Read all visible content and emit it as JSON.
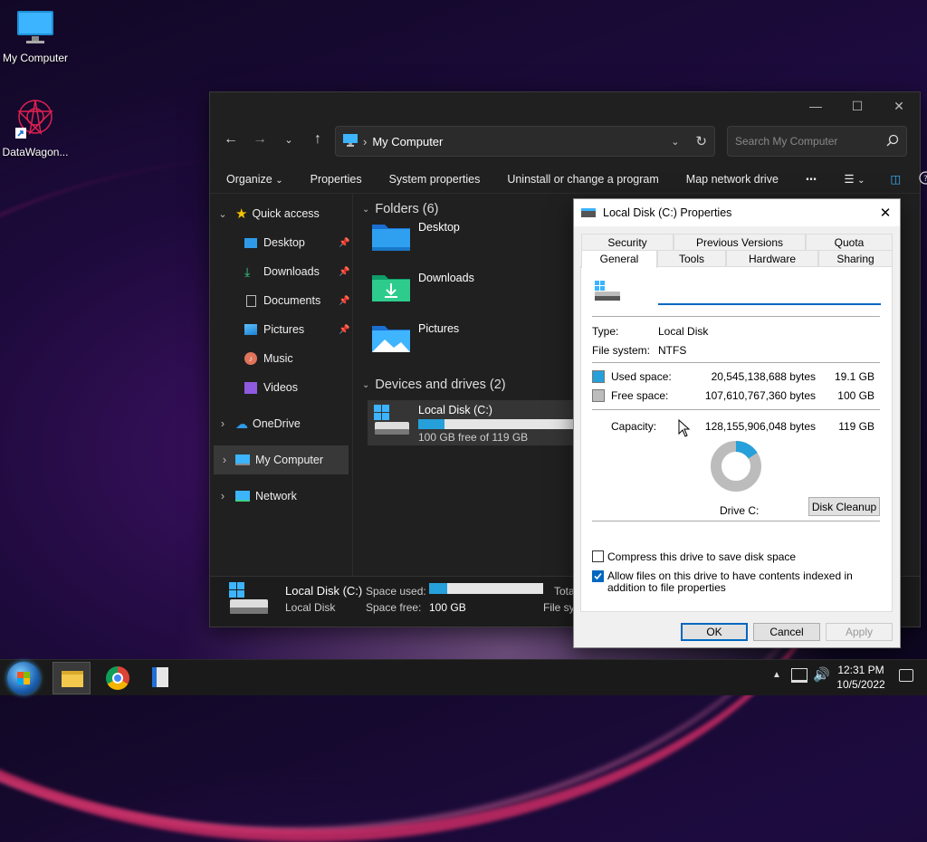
{
  "desktop": {
    "icons": [
      {
        "label": "My Computer"
      },
      {
        "label": "DataWagon..."
      }
    ]
  },
  "explorer": {
    "address": {
      "location": "My Computer"
    },
    "search": {
      "placeholder": "Search My Computer"
    },
    "commands": [
      "Organize",
      "Properties",
      "System properties",
      "Uninstall or change a program",
      "Map network drive"
    ],
    "sidebar": {
      "quick_access": "Quick access",
      "items": [
        {
          "label": "Desktop",
          "pinned": true
        },
        {
          "label": "Downloads",
          "pinned": true
        },
        {
          "label": "Documents",
          "pinned": true
        },
        {
          "label": "Pictures",
          "pinned": true
        },
        {
          "label": "Music",
          "pinned": false
        },
        {
          "label": "Videos",
          "pinned": false
        }
      ],
      "onedrive": "OneDrive",
      "my_computer": "My Computer",
      "network": "Network"
    },
    "folders_header": "Folders (6)",
    "folders": [
      "Desktop",
      "Downloads",
      "Pictures"
    ],
    "devices_header": "Devices and drives (2)",
    "drive": {
      "name": "Local Disk (C:)",
      "free_text": "100 GB free of 119 GB",
      "used_fraction": 0.16
    },
    "status": {
      "name": "Local Disk (C:)",
      "type": "Local Disk",
      "space_used_label": "Space used:",
      "space_free_label": "Space free:",
      "space_free_value": "100 GB",
      "total_label": "Tota",
      "fs_label": "File sy",
      "used_fraction": 0.16
    }
  },
  "dialog": {
    "title": "Local Disk (C:) Properties",
    "tabs_row1": [
      "Security",
      "Previous Versions",
      "Quota"
    ],
    "tabs_row2": [
      "General",
      "Tools",
      "Hardware",
      "Sharing"
    ],
    "active_tab": "General",
    "name_value": "",
    "type_label": "Type:",
    "type_value": "Local Disk",
    "fs_label": "File system:",
    "fs_value": "NTFS",
    "used_label": "Used space:",
    "used_bytes": "20,545,138,688 bytes",
    "used_gb": "19.1 GB",
    "free_label": "Free space:",
    "free_bytes": "107,610,767,360 bytes",
    "free_gb": "100 GB",
    "cap_label": "Capacity:",
    "cap_bytes": "128,155,906,048 bytes",
    "cap_gb": "119 GB",
    "drive_label": "Drive C:",
    "used_fraction": 0.16,
    "colors": {
      "used": "#26a0da",
      "free": "#bcbcbc"
    },
    "cleanup_label": "Disk Cleanup",
    "compress_label": "Compress this drive to save disk space",
    "compress_checked": false,
    "index_label": "Allow files on this drive to have contents indexed in addition to file properties",
    "index_checked": true,
    "ok_label": "OK",
    "cancel_label": "Cancel",
    "apply_label": "Apply"
  },
  "taskbar": {
    "time": "12:31 PM",
    "date": "10/5/2022"
  }
}
